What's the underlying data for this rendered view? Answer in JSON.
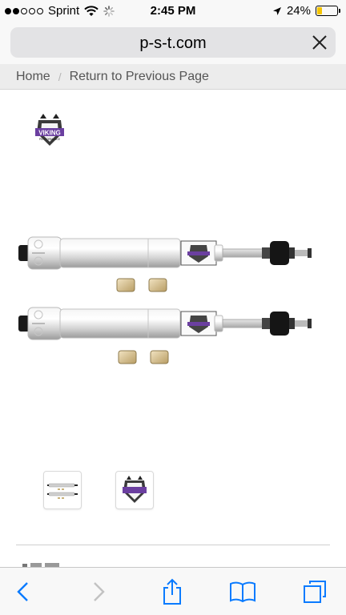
{
  "status_bar": {
    "carrier": "Sprint",
    "time": "2:45 PM",
    "battery_percent": "24%",
    "battery_level": 0.24,
    "signal_bars_filled": 2,
    "signal_bars_total": 5
  },
  "browser": {
    "url": "p-s-t.com"
  },
  "breadcrumb": {
    "items": [
      "Home",
      "Return to Previous Page"
    ],
    "separator": "/"
  },
  "product": {
    "brand_logo_text": "VIKING",
    "brand_logo_subtext": "PERFORMANCE"
  },
  "colors": {
    "battery": "#f5c400",
    "ios_blue": "#0a7bff",
    "logo_purple": "#6b3fa0"
  },
  "toolbar": {
    "icons": [
      "back-icon",
      "forward-icon",
      "share-icon",
      "bookmarks-icon",
      "tabs-icon"
    ]
  }
}
